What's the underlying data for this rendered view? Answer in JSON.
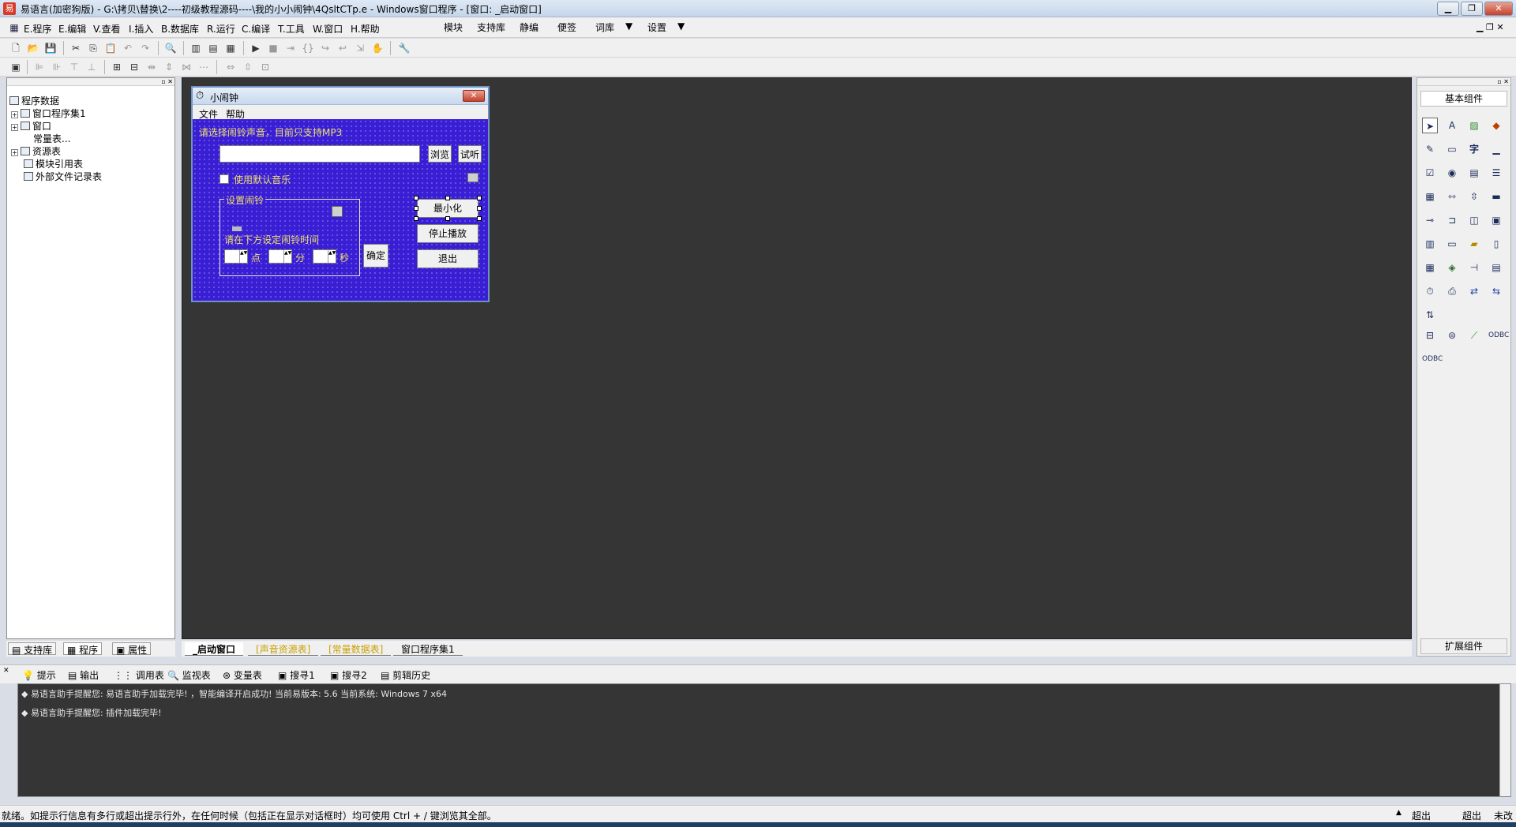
{
  "window": {
    "title": "易语言(加密狗版) - G:\\拷贝\\替换\\2----初级教程源码----\\我的小小闹钟\\4QsltCTp.e - Windows窗口程序 - [窗口: _启动窗口]",
    "min": "▁",
    "restore": "❐",
    "close": "✕"
  },
  "menu": {
    "items": [
      "E.程序",
      "E.编辑",
      "V.查看",
      "I.插入",
      "B.数据库",
      "R.运行",
      "C.编译",
      "T.工具",
      "W.窗口",
      "H.帮助"
    ],
    "extras": [
      "模块",
      "支持库",
      "静编",
      "便签",
      "词库",
      "设置"
    ]
  },
  "tree": {
    "root": "程序数据",
    "items": [
      "窗口程序集1",
      "窗口",
      "常量表...",
      "资源表",
      "模块引用表",
      "外部文件记录表"
    ]
  },
  "left_tabs": [
    "支持库",
    "程序",
    "属性"
  ],
  "form": {
    "title": "小闹钟",
    "menu_file": "文件",
    "menu_help": "帮助",
    "prompt": "请选择闹铃声音，目前只支持MP3",
    "browse": "浏览",
    "preview": "试听",
    "default_music": "使用默认音乐",
    "group_label": "设置闹铃",
    "time_prompt": "请在下方设定闹铃时间",
    "hour": "点",
    "minute": "分",
    "second": "秒",
    "confirm": "确定",
    "minimize": "最小化",
    "stop": "停止播放",
    "exit": "退出"
  },
  "doc_tabs": [
    "_启动窗口",
    "[声音资源表]",
    "[常量数据表]",
    "窗口程序集1"
  ],
  "right_panel": {
    "basic": "基本组件",
    "extended": "扩展组件"
  },
  "bottom_tabs": [
    "提示",
    "输出",
    "调用表",
    "监视表",
    "变量表",
    "搜寻1",
    "搜寻2",
    "剪辑历史"
  ],
  "output_lines": [
    "◆ 易语言助手提醒您: 易语言助手加载完毕! ，智能编译开启成功! 当前易版本: 5.6 当前系统: Windows 7 x64",
    "◆ 易语言助手提醒您: 插件加载完毕!"
  ],
  "status": {
    "text": "就绪。如提示行信息有多行或超出提示行外，在任何时候（包括正在显示对话框时）均可使用 Ctrl + / 键浏览其全部。",
    "overwrite1": "超出",
    "overwrite2": "超出",
    "save": "未改"
  }
}
